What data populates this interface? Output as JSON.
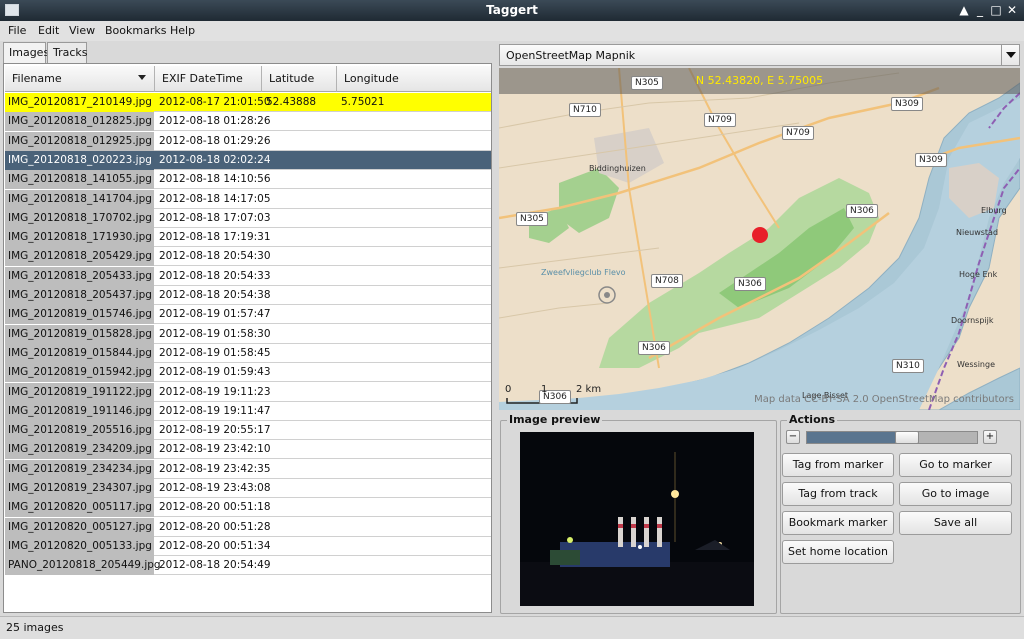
{
  "window": {
    "title": "Taggert"
  },
  "menu": {
    "file": "File",
    "edit": "Edit",
    "view": "View",
    "bookmarks": "Bookmarks",
    "help": "Help"
  },
  "tabs": {
    "images": "Images",
    "tracks": "Tracks"
  },
  "table": {
    "columns": {
      "filename": "Filename",
      "exif": "EXIF DateTime",
      "lat": "Latitude",
      "lon": "Longitude"
    },
    "rows": [
      {
        "file": "IMG_20120817_210149.jpg",
        "date": "2012-08-17 21:01:50",
        "lat": "52.43888",
        "lon": "5.75021"
      },
      {
        "file": "IMG_20120818_012825.jpg",
        "date": "2012-08-18 01:28:26",
        "lat": "",
        "lon": ""
      },
      {
        "file": "IMG_20120818_012925.jpg",
        "date": "2012-08-18 01:29:26",
        "lat": "",
        "lon": ""
      },
      {
        "file": "IMG_20120818_020223.jpg",
        "date": "2012-08-18 02:02:24",
        "lat": "",
        "lon": ""
      },
      {
        "file": "IMG_20120818_141055.jpg",
        "date": "2012-08-18 14:10:56",
        "lat": "",
        "lon": ""
      },
      {
        "file": "IMG_20120818_141704.jpg",
        "date": "2012-08-18 14:17:05",
        "lat": "",
        "lon": ""
      },
      {
        "file": "IMG_20120818_170702.jpg",
        "date": "2012-08-18 17:07:03",
        "lat": "",
        "lon": ""
      },
      {
        "file": "IMG_20120818_171930.jpg",
        "date": "2012-08-18 17:19:31",
        "lat": "",
        "lon": ""
      },
      {
        "file": "IMG_20120818_205429.jpg",
        "date": "2012-08-18 20:54:30",
        "lat": "",
        "lon": ""
      },
      {
        "file": "IMG_20120818_205433.jpg",
        "date": "2012-08-18 20:54:33",
        "lat": "",
        "lon": ""
      },
      {
        "file": "IMG_20120818_205437.jpg",
        "date": "2012-08-18 20:54:38",
        "lat": "",
        "lon": ""
      },
      {
        "file": "IMG_20120819_015746.jpg",
        "date": "2012-08-19 01:57:47",
        "lat": "",
        "lon": ""
      },
      {
        "file": "IMG_20120819_015828.jpg",
        "date": "2012-08-19 01:58:30",
        "lat": "",
        "lon": ""
      },
      {
        "file": "IMG_20120819_015844.jpg",
        "date": "2012-08-19 01:58:45",
        "lat": "",
        "lon": ""
      },
      {
        "file": "IMG_20120819_015942.jpg",
        "date": "2012-08-19 01:59:43",
        "lat": "",
        "lon": ""
      },
      {
        "file": "IMG_20120819_191122.jpg",
        "date": "2012-08-19 19:11:23",
        "lat": "",
        "lon": ""
      },
      {
        "file": "IMG_20120819_191146.jpg",
        "date": "2012-08-19 19:11:47",
        "lat": "",
        "lon": ""
      },
      {
        "file": "IMG_20120819_205516.jpg",
        "date": "2012-08-19 20:55:17",
        "lat": "",
        "lon": ""
      },
      {
        "file": "IMG_20120819_234209.jpg",
        "date": "2012-08-19 23:42:10",
        "lat": "",
        "lon": ""
      },
      {
        "file": "IMG_20120819_234234.jpg",
        "date": "2012-08-19 23:42:35",
        "lat": "",
        "lon": ""
      },
      {
        "file": "IMG_20120819_234307.jpg",
        "date": "2012-08-19 23:43:08",
        "lat": "",
        "lon": ""
      },
      {
        "file": "IMG_20120820_005117.jpg",
        "date": "2012-08-20 00:51:18",
        "lat": "",
        "lon": ""
      },
      {
        "file": "IMG_20120820_005127.jpg",
        "date": "2012-08-20 00:51:28",
        "lat": "",
        "lon": ""
      },
      {
        "file": "IMG_20120820_005133.jpg",
        "date": "2012-08-20 00:51:34",
        "lat": "",
        "lon": ""
      },
      {
        "file": "PANO_20120818_205449.jpg",
        "date": "2012-08-18 20:54:49",
        "lat": "",
        "lon": ""
      }
    ]
  },
  "map": {
    "source": "OpenStreetMap Mapnik",
    "coords": "N 52.43820, E 5.75005",
    "attribution": "Map data CC-BY-SA 2.0 OpenStreetMap contributors",
    "scale": {
      "zero": "0",
      "one": "1",
      "two": "2 km"
    },
    "roads": {
      "n305a": "N305",
      "n710": "N710",
      "n709a": "N709",
      "n709b": "N709",
      "n309a": "N309",
      "n309b": "N309",
      "n305b": "N305",
      "n306a": "N306",
      "n708": "N708",
      "n306b": "N306",
      "n306c": "N306",
      "n310": "N310",
      "n306d": "N306"
    },
    "places": {
      "biddinghuizen": "Biddinghuizen",
      "elburg": "Elburg",
      "nieuwstad": "Nieuwstad",
      "hoge_enk": "Hoge Enk",
      "doornspijk": "Doornspijk",
      "wessinge": "Wessinge",
      "zweefvliegclub": "Zweefvliegclub Flevo",
      "lage_bisse": "Lage Bisset"
    }
  },
  "preview": {
    "title": "Image preview"
  },
  "actions": {
    "title": "Actions",
    "zoom_out": "−",
    "zoom_in": "+",
    "zoom_level": 0.6,
    "tag_from_marker": "Tag from marker",
    "go_to_marker": "Go to marker",
    "tag_from_track": "Tag from track",
    "go_to_image": "Go to image",
    "bookmark_marker": "Bookmark marker",
    "save_all": "Save all",
    "set_home": "Set home location"
  },
  "status": {
    "text": "25 images"
  },
  "colors": {
    "highlight_yellow": "#ffff00",
    "selection_blue": "#4a6279",
    "marker_red": "#e8202a",
    "coord_text": "#ffea00"
  }
}
